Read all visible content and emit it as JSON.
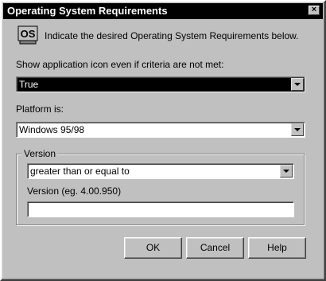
{
  "window": {
    "title": "Operating System Requirements",
    "close_label": "×"
  },
  "intro": {
    "icon_text": "OS",
    "icon": "os-icon",
    "text": "Indicate the desired Operating System Requirements below."
  },
  "show_icon": {
    "label": "Show application icon even if criteria are not met:",
    "value": "True"
  },
  "platform": {
    "label": "Platform is:",
    "value": "Windows 95/98"
  },
  "version_group": {
    "legend": "Version",
    "comparison_value": "greater than or equal to",
    "version_label": "Version (eg. 4.00.950)",
    "version_value": ""
  },
  "buttons": {
    "ok": "OK",
    "cancel": "Cancel",
    "help": "Help"
  }
}
